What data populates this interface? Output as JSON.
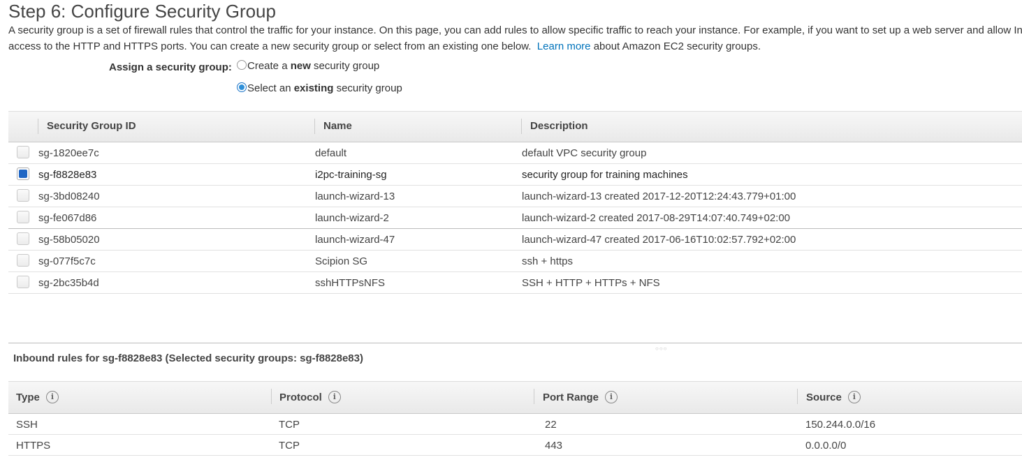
{
  "page": {
    "title": "Step 6: Configure Security Group",
    "intro_line1": "A security group is a set of firewall rules that control the traffic for your instance. On this page, you can add rules to allow specific traffic to reach your instance. For example, if you want to set up a web server and allow Interne",
    "intro_line2_pre": "access to the HTTP and HTTPS ports. You can create a new security group or select from an existing one below.",
    "learn_more": "Learn more",
    "intro_line2_post": "about Amazon EC2 security groups."
  },
  "assign": {
    "label": "Assign a security group:",
    "option_new": {
      "pre": "Create a ",
      "bold": "new",
      "post": " security group",
      "selected": false
    },
    "option_existing": {
      "pre": "Select an ",
      "bold": "existing",
      "post": " security group",
      "selected": true
    }
  },
  "security_groups": {
    "columns": [
      "Security Group ID",
      "Name",
      "Description"
    ],
    "rows": [
      {
        "id": "sg-1820ee7c",
        "name": "default",
        "description": "default VPC security group",
        "checked": false
      },
      {
        "id": "sg-f8828e83",
        "name": "i2pc-training-sg",
        "description": "security group for training machines",
        "checked": true
      },
      {
        "id": "sg-3bd08240",
        "name": "launch-wizard-13",
        "description": "launch-wizard-13 created 2017-12-20T12:24:43.779+01:00",
        "checked": false
      },
      {
        "id": "sg-fe067d86",
        "name": "launch-wizard-2",
        "description": "launch-wizard-2 created 2017-08-29T14:07:40.749+02:00",
        "checked": false
      },
      {
        "id": "sg-58b05020",
        "name": "launch-wizard-47",
        "description": "launch-wizard-47 created 2017-06-16T10:02:57.792+02:00",
        "checked": false
      },
      {
        "id": "sg-077f5c7c",
        "name": "Scipion SG",
        "description": "ssh + https",
        "checked": false
      },
      {
        "id": "sg-2bc35b4d",
        "name": "sshHTTPsNFS",
        "description": "SSH + HTTP + HTTPs + NFS",
        "checked": false
      }
    ]
  },
  "inbound": {
    "title": "Inbound rules for sg-f8828e83 (Selected security groups: sg-f8828e83)",
    "columns": [
      "Type",
      "Protocol",
      "Port Range",
      "Source"
    ],
    "info_glyph": "i",
    "rows": [
      {
        "type": "SSH",
        "protocol": "TCP",
        "port_range": "22",
        "source": "150.244.0.0/16"
      },
      {
        "type": "HTTPS",
        "protocol": "TCP",
        "port_range": "443",
        "source": "0.0.0.0/0"
      }
    ]
  }
}
